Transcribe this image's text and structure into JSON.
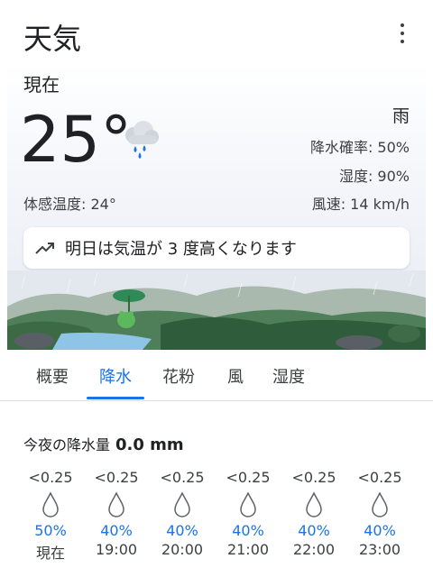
{
  "header": {
    "title": "天気",
    "menu_icon": "more-vert-icon"
  },
  "current": {
    "label": "現在",
    "temperature": "25°",
    "condition": "雨",
    "precip_chance": "降水確率: 50%",
    "humidity": "湿度: 90%",
    "wind": "風速: 14 km/h",
    "feels_like": "体感温度: 24°",
    "weather_icon": "cloud-rain-icon"
  },
  "banner": {
    "icon": "trending-up-icon",
    "text": "明日は気温が 3 度高くなります"
  },
  "tabs": [
    {
      "label": "概要",
      "active": false
    },
    {
      "label": "降水",
      "active": true
    },
    {
      "label": "花粉",
      "active": false
    },
    {
      "label": "風",
      "active": false
    },
    {
      "label": "湿度",
      "active": false
    }
  ],
  "precip": {
    "label": "今夜の降水量",
    "total": "0.0 mm",
    "hours": [
      {
        "amount": "<0.25",
        "chance": "50%",
        "time": "現在"
      },
      {
        "amount": "<0.25",
        "chance": "40%",
        "time": "19:00"
      },
      {
        "amount": "<0.25",
        "chance": "40%",
        "time": "20:00"
      },
      {
        "amount": "<0.25",
        "chance": "40%",
        "time": "21:00"
      },
      {
        "amount": "<0.25",
        "chance": "40%",
        "time": "22:00"
      },
      {
        "amount": "<0.25",
        "chance": "40%",
        "time": "23:00"
      }
    ]
  },
  "colors": {
    "accent": "#1a73e8",
    "text": "#202124",
    "rain_blue": "#1a73e8"
  }
}
